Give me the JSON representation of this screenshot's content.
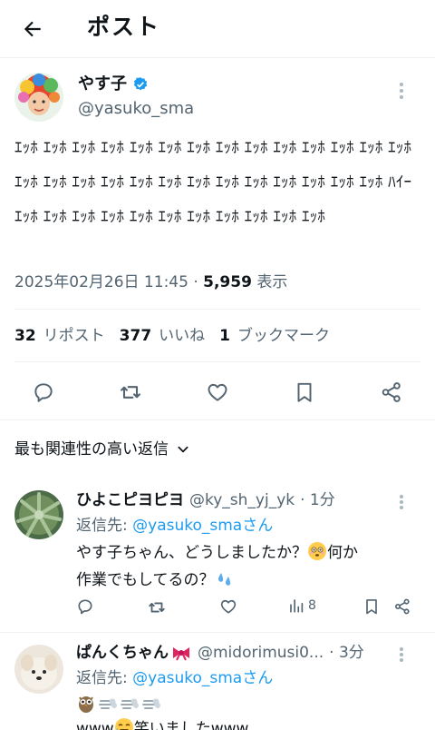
{
  "header": {
    "title": "ポスト"
  },
  "post": {
    "author_name": "やす子",
    "author_handle": "@yasuko_sma",
    "body": "ｴｯﾎ ｴｯﾎ ｴｯﾎ ｴｯﾎ ｴｯﾎ ｴｯﾎ ｴｯﾎ ｴｯﾎ ｴｯﾎ ｴｯﾎ ｴｯﾎ ｴｯﾎ ｴｯﾎ ｴｯﾎ ｴｯﾎ ｴｯﾎ ｴｯﾎ ｴｯﾎ ｴｯﾎ ｴｯﾎ ｴｯﾎ ｴｯﾎ ｴｯﾎ ｴｯﾎ ｴｯﾎ ｴｯﾎ ｴｯﾎ ﾊｲｰ ｴｯﾎ ｴｯﾎ ｴｯﾎ ｴｯﾎ ｴｯﾎ ｴｯﾎ ｴｯﾎ ｴｯﾎ ｴｯﾎ ｴｯﾎ ｴｯﾎ",
    "date": "2025年02月26日 11:45 · ",
    "views_count": "5,959",
    "views_label": " 表示",
    "reposts_count": "32",
    "reposts_label": "リポスト",
    "likes_count": "377",
    "likes_label": "いいね",
    "bookmarks_count": "1",
    "bookmarks_label": "ブックマーク"
  },
  "sort": {
    "label": "最も関連性の高い返信"
  },
  "replies": [
    {
      "name": "ひよこピヨピヨ",
      "handle": "@ky_sh_yj_yk",
      "time": "· 1分",
      "reply_prefix": "返信先: ",
      "reply_to": "@yasuko_smaさん",
      "line1": "やす子ちゃん、どうしましたか？",
      "line1b": "何か",
      "line2": "作業でもしてるの？",
      "views": "8"
    },
    {
      "name": "ぱんくちゃん",
      "handle": "@midorimusi0...",
      "time": "· 3分",
      "reply_prefix": "返信先: ",
      "reply_to": "@yasuko_smaさん",
      "line3": "www",
      "line3b": "笑いましたwww"
    }
  ],
  "colors": {
    "accent": "#1d9bf0",
    "muted": "#536471",
    "text": "#0f1419",
    "divider": "#eff3f4"
  },
  "icons": [
    "back-arrow-icon",
    "verified-badge-icon",
    "more-icon",
    "reply-icon",
    "repost-icon",
    "like-icon",
    "bookmark-icon",
    "share-icon",
    "chevron-down-icon",
    "views-icon",
    "flushed-emoji-icon",
    "sweat-droplets-icon",
    "ribbon-icon",
    "owl-emoji-icon",
    "dash-emoji-icon",
    "rofl-emoji-icon"
  ]
}
